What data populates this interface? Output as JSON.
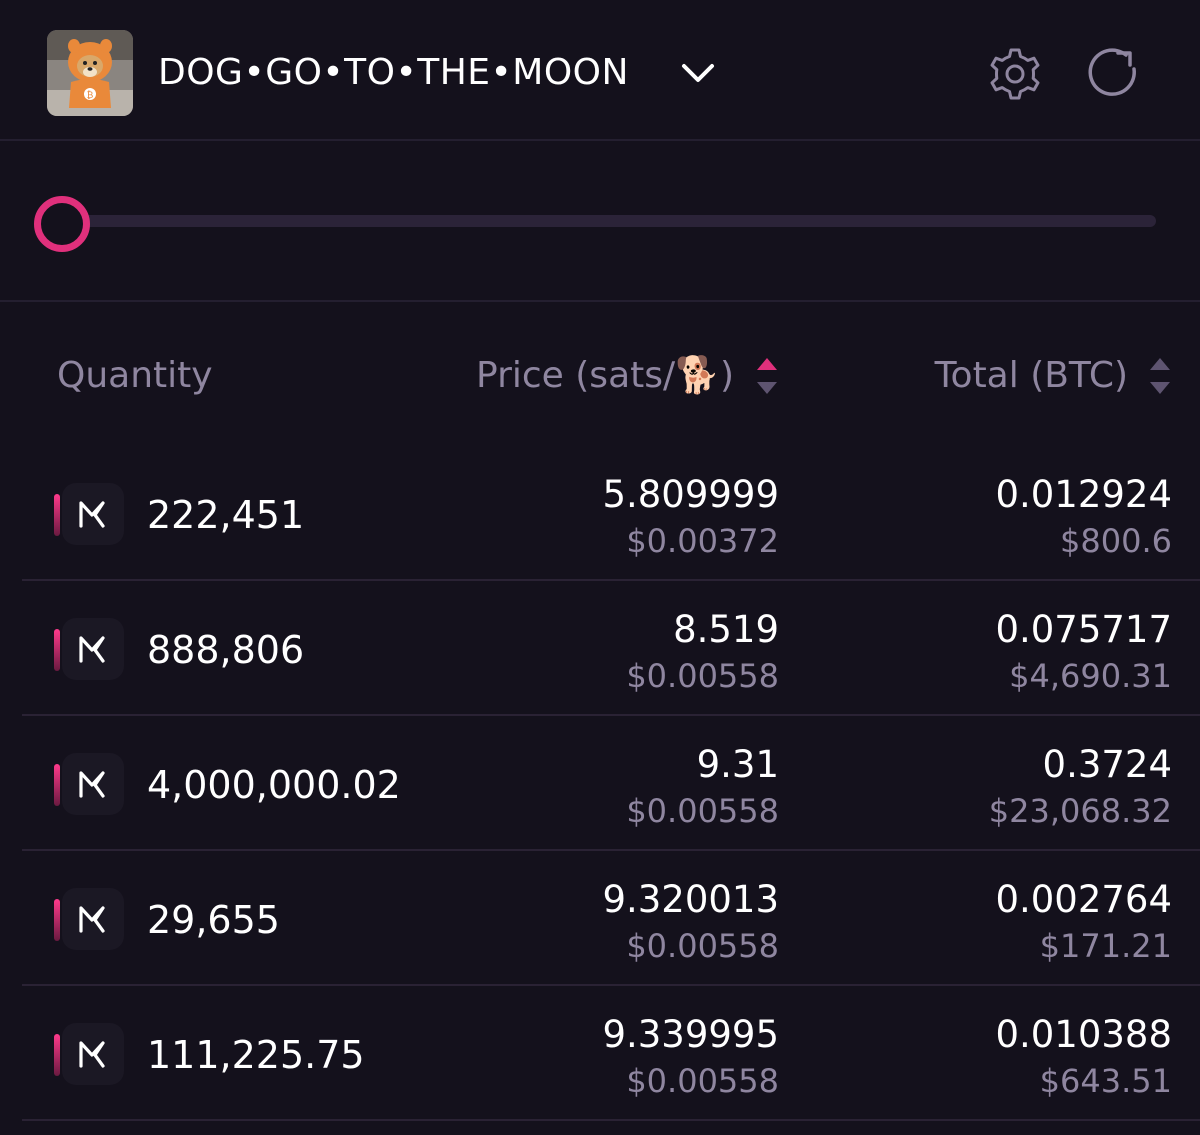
{
  "header": {
    "token_name": "DOG•GO•TO•THE•MOON",
    "icons": {
      "avatar": "dog-avatar",
      "dropdown": "chevron-down-icon",
      "settings": "gear-icon",
      "refresh": "refresh-icon"
    }
  },
  "slider": {
    "value_fraction": 0.0
  },
  "table": {
    "columns": {
      "quantity": "Quantity",
      "price": "Price (sats/🐕)",
      "total": "Total (BTC)"
    },
    "rows": [
      {
        "quantity": "222,451",
        "price": "5.809999",
        "price_usd": "$0.00372",
        "total": "0.012924",
        "total_usd": "$800.6"
      },
      {
        "quantity": "888,806",
        "price": "8.519",
        "price_usd": "$0.00558",
        "total": "0.075717",
        "total_usd": "$4,690.31"
      },
      {
        "quantity": "4,000,000.02",
        "price": "9.31",
        "price_usd": "$0.00558",
        "total": "0.3724",
        "total_usd": "$23,068.32"
      },
      {
        "quantity": "29,655",
        "price": "9.320013",
        "price_usd": "$0.00558",
        "total": "0.002764",
        "total_usd": "$171.21"
      },
      {
        "quantity": "111,225.75",
        "price": "9.339995",
        "price_usd": "$0.00558",
        "total": "0.010388",
        "total_usd": "$643.51"
      }
    ]
  },
  "colors": {
    "background": "#14111c",
    "accent": "#e0307c",
    "muted_text": "#8f86a0",
    "divider": "#2a2234"
  }
}
